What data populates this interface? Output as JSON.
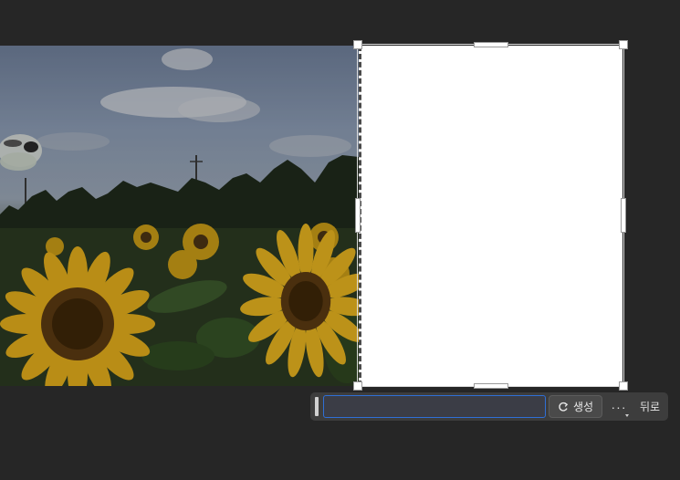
{
  "taskbar": {
    "prompt_value": "",
    "generate_label": "생성",
    "more_label": "···",
    "back_label": "뒤로"
  },
  "icons": {
    "generate": "refresh-sparkle-icon",
    "more": "more-options-icon",
    "grip": "drag-handle-icon"
  },
  "colors": {
    "app_background": "#262626",
    "taskbar_background": "#3d3d3d",
    "prompt_border": "#2f6fd6",
    "fill_area": "#ffffff"
  }
}
